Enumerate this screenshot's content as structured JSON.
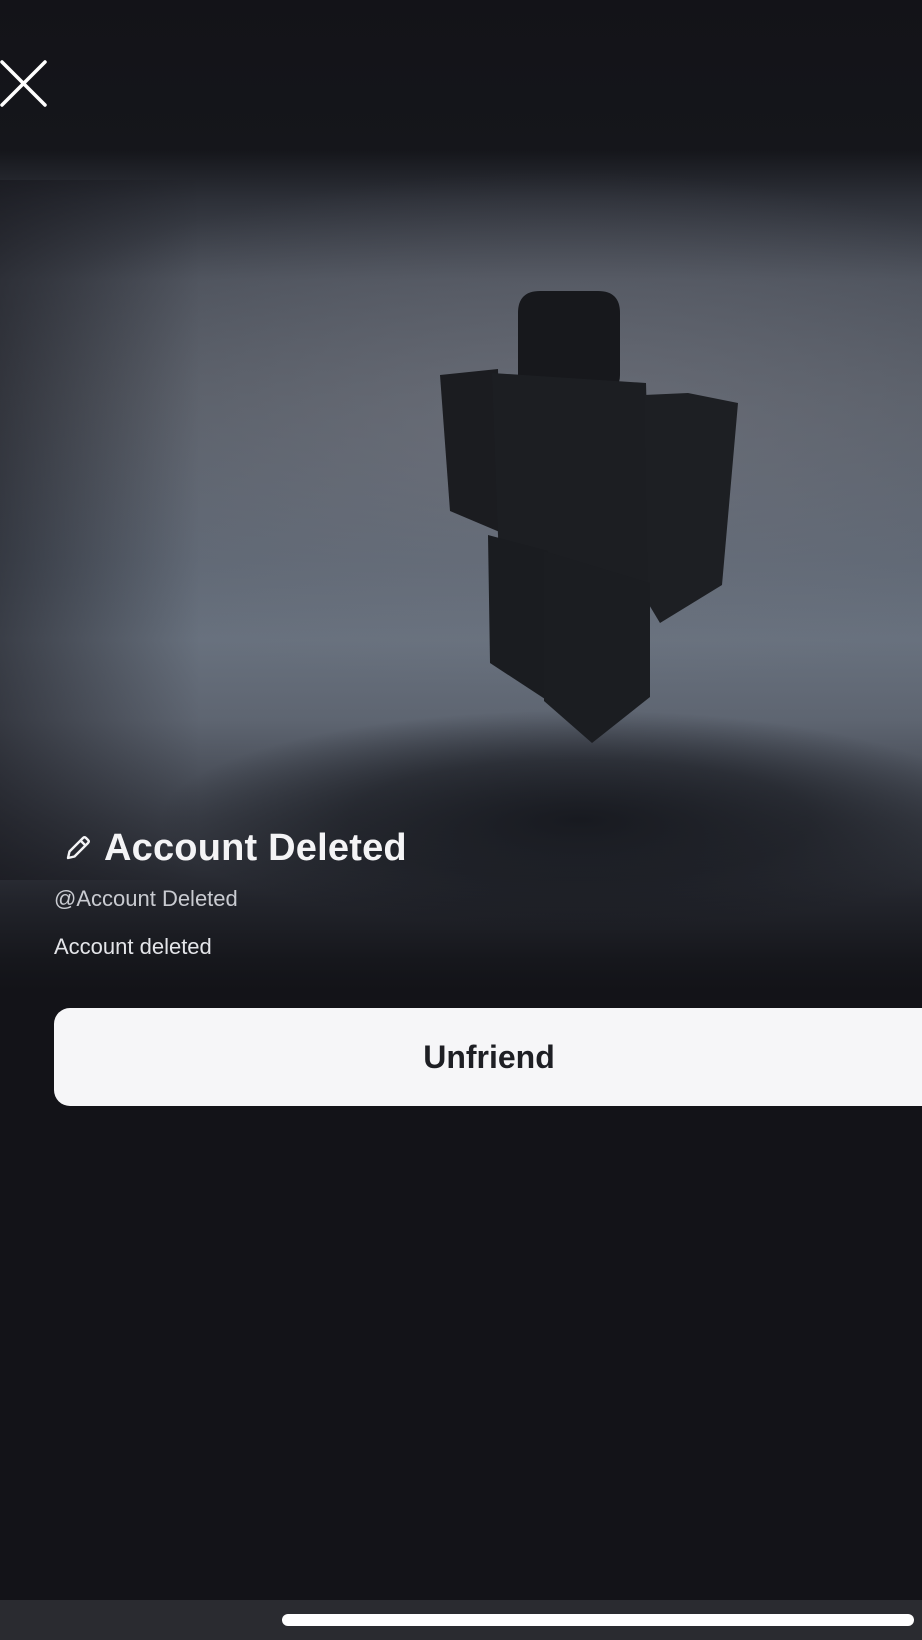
{
  "profile": {
    "display_name": "Account Deleted",
    "username": "@Account Deleted",
    "status": "Account deleted"
  },
  "actions": {
    "unfriend_label": "Unfriend"
  },
  "icons": {
    "close": "close-icon",
    "edit": "pencil-icon"
  },
  "colors": {
    "background": "#131318",
    "button_bg": "#f6f6f8",
    "button_text": "#1e1f24",
    "avatar": "#1c1e22"
  }
}
